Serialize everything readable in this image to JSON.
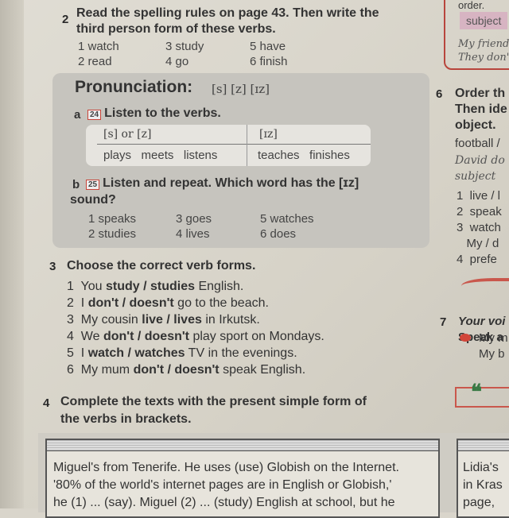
{
  "ex2": {
    "num": "2",
    "title1": "Read the spelling rules on page 43. Then write the",
    "title2": "third person form of these verbs.",
    "items": [
      "1  watch",
      "3  study",
      "5  have",
      "2  read",
      "4  go",
      "6  finish"
    ]
  },
  "pron": {
    "title": "Pronunciation:",
    "sounds": "[s] [z] [ɪz]",
    "a": {
      "letter": "a",
      "cd": "24",
      "text": "Listen to the verbs."
    },
    "table": {
      "headers": [
        "[s] or [z]",
        "[ɪz]"
      ],
      "col1": "plays   meets   listens",
      "col2": "teaches   finishes"
    },
    "b": {
      "letter": "b",
      "cd": "25",
      "text1": "Listen and repeat. Which word has the [ɪz]",
      "text2": "sound?"
    },
    "items": [
      "1  speaks",
      "3  goes",
      "5  watches",
      "2  studies",
      "4  lives",
      "6  does"
    ]
  },
  "ex3": {
    "num": "3",
    "title": "Choose the correct verb forms.",
    "items": [
      {
        "n": "1",
        "a": "You ",
        "b": "study / studies",
        "c": " English."
      },
      {
        "n": "2",
        "a": "I ",
        "b": "don't / doesn't",
        "c": " go to the beach."
      },
      {
        "n": "3",
        "a": "My cousin ",
        "b": "live / lives",
        "c": " in Irkutsk."
      },
      {
        "n": "4",
        "a": "We ",
        "b": "don't / doesn't",
        "c": " play sport on Mondays."
      },
      {
        "n": "5",
        "a": "I ",
        "b": "watch / watches",
        "c": " TV in the evenings."
      },
      {
        "n": "6",
        "a": "My mum ",
        "b": "don't / doesn't",
        "c": " speak English."
      }
    ]
  },
  "ex4": {
    "num": "4",
    "title1": "Complete the texts with the present simple form of",
    "title2": "the verbs in brackets.",
    "lines": [
      "Miguel's from Tenerife. He uses (use) Globish on the Internet.",
      "'80% of the world's internet pages are in English or Globish,'",
      "he (1) ... (say). Miguel (2) ... (study) English at school, but he"
    ],
    "right_lines": [
      "Lidia's",
      "in Kras",
      "page,"
    ]
  },
  "right": {
    "top": "order.",
    "subject": "subject",
    "ex_lines": [
      "My friends",
      "They don't"
    ],
    "ex6": {
      "num": "6",
      "title": [
        "Order th",
        "Then ide",
        "object."
      ],
      "example": "football /",
      "example_it": [
        "David do",
        "subject"
      ],
      "items": [
        "1  live / l",
        "2  speak",
        "3  watch",
        "   My / d",
        "4  prefe"
      ]
    },
    "ex7": {
      "num": "7",
      "title_it": "Your voi",
      "title2": "Speak a",
      "lines": [
        "My m",
        "My b"
      ]
    }
  }
}
